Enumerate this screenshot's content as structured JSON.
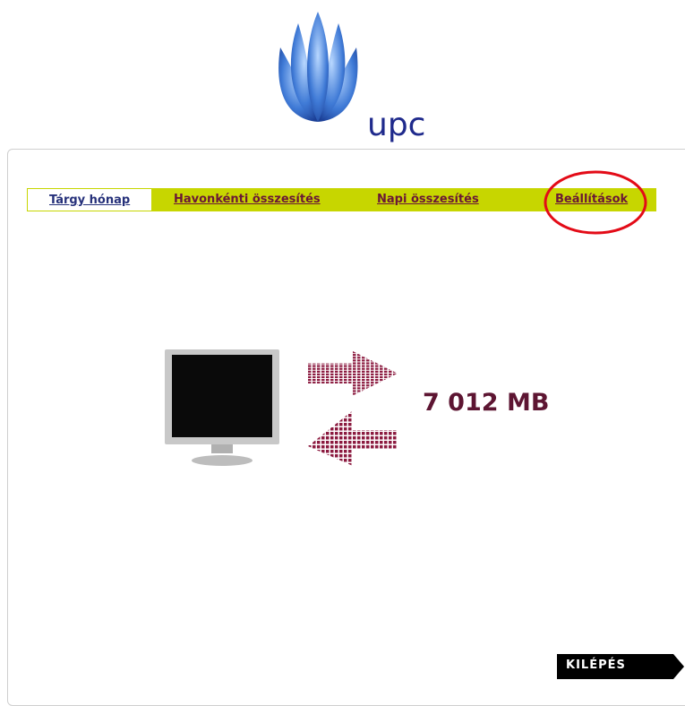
{
  "brand": {
    "name": "upc",
    "logo_icon": "upc-flower-logo-icon",
    "color": "#1f2a8c"
  },
  "nav": {
    "bar_color": "#c7d600",
    "tabs": [
      {
        "label": "Tárgy hónap",
        "active": true
      },
      {
        "label": "Havonkénti összesítés",
        "active": false
      },
      {
        "label": "Napi összesítés",
        "active": false
      },
      {
        "label": "Beállítások",
        "active": false
      }
    ]
  },
  "annotation": {
    "icon": "red-circle-highlight-icon",
    "target": "Beállítások",
    "color": "#e30b17"
  },
  "usage": {
    "monitor_icon": "monitor-icon",
    "transfer_icon": "transfer-arrows-icon",
    "value": "7 012 MB",
    "color": "#5d1532"
  },
  "logout": {
    "label": "KILÉPÉS"
  }
}
